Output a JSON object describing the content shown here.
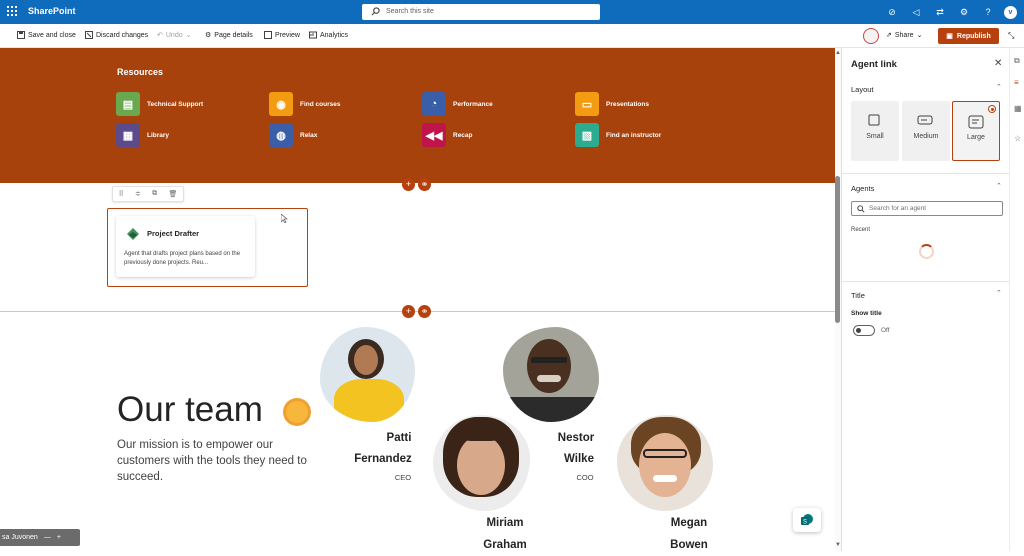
{
  "app": {
    "name": "SharePoint",
    "search_placeholder": "Search this site",
    "user_initial": "v"
  },
  "command_bar": {
    "save_close": "Save and close",
    "discard": "Discard changes",
    "undo": "Undo",
    "page_details": "Page details",
    "preview": "Preview",
    "analytics": "Analytics",
    "share": "Share",
    "republish": "Republish"
  },
  "hero": {
    "title": "Resources",
    "links": [
      {
        "label": "Technical Support",
        "icon": "chat-icon",
        "color": "#6aa84f"
      },
      {
        "label": "Find courses",
        "icon": "location-icon",
        "color": "#f39c12"
      },
      {
        "label": "Performance",
        "icon": "gauge-icon",
        "color": "#3b5ea8"
      },
      {
        "label": "Presentations",
        "icon": "presentation-icon",
        "color": "#f39c12"
      },
      {
        "label": "Library",
        "icon": "library-icon",
        "color": "#5b4b8a"
      },
      {
        "label": "Relax",
        "icon": "gamepad-icon",
        "color": "#3b5ea8"
      },
      {
        "label": "Recap",
        "icon": "rewind-icon",
        "color": "#c0144a"
      },
      {
        "label": "Find an instructor",
        "icon": "document-icon",
        "color": "#2bab8f"
      }
    ]
  },
  "agent_card": {
    "title": "Project Drafter",
    "description": "Agent that drafts project plans based on the previously done projects. Reu..."
  },
  "team": {
    "title": "Our team",
    "mission": "Our mission is to empower our customers with the tools they need to succeed.",
    "members": [
      {
        "first": "Patti",
        "last": "Fernandez",
        "role": "CEO"
      },
      {
        "first": "Nestor",
        "last": "Wilke",
        "role": "COO"
      },
      {
        "first": "Miriam",
        "last": "Graham",
        "role": ""
      },
      {
        "first": "Megan",
        "last": "Bowen",
        "role": ""
      }
    ]
  },
  "user_chip": {
    "name": "sa Juvonen"
  },
  "panel": {
    "title": "Agent link",
    "layout_label": "Layout",
    "layout_options": [
      "Small",
      "Medium",
      "Large"
    ],
    "selected_layout": "Large",
    "agents_label": "Agents",
    "search_placeholder": "Search for an agent",
    "recent_label": "Recent",
    "title_section": "Title",
    "show_title_label": "Show title",
    "show_title_state": "Off"
  },
  "colors": {
    "accent": "#b7410e",
    "suite_bar": "#0f6cbd",
    "hero_bg": "#a8420c"
  }
}
